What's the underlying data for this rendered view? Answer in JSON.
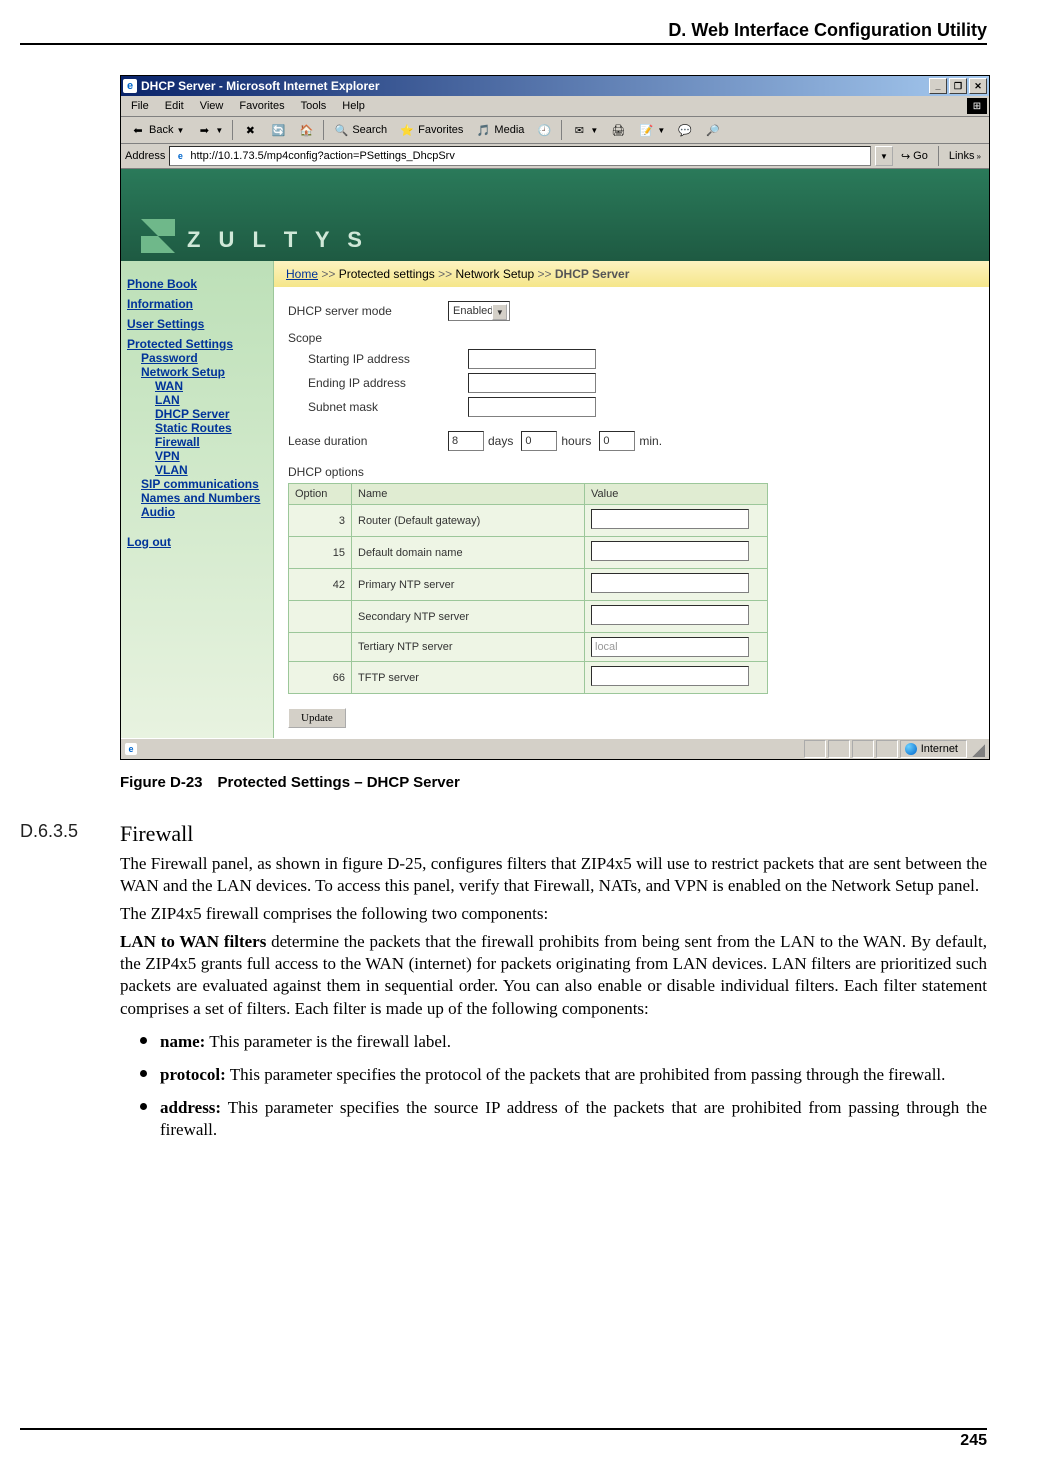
{
  "page": {
    "header": "D. Web Interface Configuration Utility",
    "number": "245"
  },
  "ie": {
    "title": "DHCP Server - Microsoft Internet Explorer",
    "menu": [
      "File",
      "Edit",
      "View",
      "Favorites",
      "Tools",
      "Help"
    ],
    "toolbar": {
      "back": "Back",
      "search": "Search",
      "favorites": "Favorites",
      "media": "Media"
    },
    "address_label": "Address",
    "url": "http://10.1.73.5/mp4config?action=PSettings_DhcpSrv",
    "go": "Go",
    "links": "Links",
    "status_zone": "Internet"
  },
  "app": {
    "brand": "Z U L T Y S",
    "crumb_home": "Home",
    "crumb_ps": "Protected settings",
    "crumb_ns": "Network Setup",
    "crumb_cur": "DHCP Server",
    "nav": {
      "phone_book": "Phone Book",
      "information": "Information",
      "user_settings": "User Settings",
      "protected": "Protected Settings",
      "password": "Password",
      "network_setup": "Network Setup",
      "wan": "WAN",
      "lan": "LAN",
      "dhcp": "DHCP Server",
      "static": "Static Routes",
      "firewall": "Firewall",
      "vpn": "VPN",
      "vlan": "VLAN",
      "sip": "SIP communications",
      "names": "Names and Numbers",
      "audio": "Audio",
      "logout": "Log out"
    },
    "form": {
      "mode_label": "DHCP server mode",
      "mode_value": "Enabled",
      "scope_label": "Scope",
      "start_label": "Starting IP address",
      "end_label": "Ending IP address",
      "mask_label": "Subnet mask",
      "lease_label": "Lease duration",
      "lease_days": "8",
      "lease_days_unit": "days",
      "lease_hours": "0",
      "lease_hours_unit": "hours",
      "lease_min": "0",
      "lease_min_unit": "min.",
      "opts_label": "DHCP options",
      "th_option": "Option",
      "th_name": "Name",
      "th_value": "Value",
      "rows": [
        {
          "opt": "3",
          "name": "Router (Default gateway)",
          "val": ""
        },
        {
          "opt": "15",
          "name": "Default domain name",
          "val": ""
        },
        {
          "opt": "42",
          "name": "Primary NTP server",
          "val": ""
        },
        {
          "opt": "",
          "name": "Secondary NTP server",
          "val": ""
        },
        {
          "opt": "",
          "name": "Tertiary NTP server",
          "val": "local"
        },
        {
          "opt": "66",
          "name": "TFTP server",
          "val": ""
        }
      ],
      "update": "Update"
    }
  },
  "caption": "Figure D-23 Protected Settings – DHCP Server",
  "section": {
    "num": "D.6.3.5",
    "title": "Firewall",
    "p1": "The Firewall panel, as shown in figure D-25, configures filters that ZIP4x5 will use to restrict packets that are sent between the WAN and the LAN devices. To access this panel, verify that Firewall, NATs, and VPN is enabled on the Network Setup panel.",
    "p2": "The ZIP4x5 firewall comprises the following two components:",
    "p3a": "LAN to WAN filters",
    "p3b": " determine the packets that the firewall prohibits from being sent from the LAN to the WAN. By default, the ZIP4x5 grants full access to the WAN (internet) for packets originating from LAN devices. LAN filters are prioritized such packets are evaluated against them in sequential order. You can also enable or disable individual filters. Each filter statement comprises a set of filters. Each filter is made up of the following components:",
    "b1a": "name:",
    "b1b": " This parameter is the firewall label.",
    "b2a": "protocol:",
    "b2b": " This parameter specifies the protocol of the packets that are prohibited from passing through the firewall.",
    "b3a": "address:",
    "b3b": " This parameter specifies the source IP address of the packets that are prohibited from passing through the firewall."
  }
}
